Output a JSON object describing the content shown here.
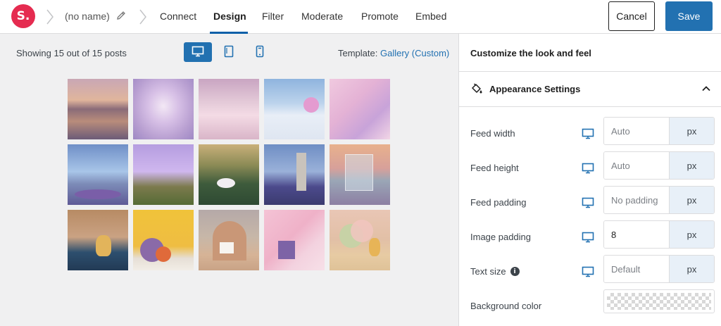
{
  "header": {
    "logo_text": "S.",
    "feed_name": "(no name)",
    "tabs": [
      {
        "label": "Connect",
        "active": false
      },
      {
        "label": "Design",
        "active": true
      },
      {
        "label": "Filter",
        "active": false
      },
      {
        "label": "Moderate",
        "active": false
      },
      {
        "label": "Promote",
        "active": false
      },
      {
        "label": "Embed",
        "active": false
      }
    ],
    "cancel_label": "Cancel",
    "save_label": "Save"
  },
  "preview": {
    "showing_text": "Showing 15 out of 15 posts",
    "devices": [
      {
        "name": "desktop",
        "active": true
      },
      {
        "name": "tablet",
        "active": false
      },
      {
        "name": "mobile",
        "active": false
      }
    ],
    "template_label": "Template:",
    "template_value": "Gallery (Custom)",
    "posts_count": 15
  },
  "sidebar": {
    "title": "Customize the look and feel",
    "section_title": "Appearance Settings",
    "section_expanded": true,
    "fields": [
      {
        "label": "Feed width",
        "value": "",
        "placeholder": "Auto",
        "unit": "px",
        "info": false
      },
      {
        "label": "Feed height",
        "value": "",
        "placeholder": "Auto",
        "unit": "px",
        "info": false
      },
      {
        "label": "Feed padding",
        "value": "",
        "placeholder": "No padding",
        "unit": "px",
        "info": false
      },
      {
        "label": "Image padding",
        "value": "8",
        "placeholder": "",
        "unit": "px",
        "info": false
      },
      {
        "label": "Text size",
        "value": "",
        "placeholder": "Default",
        "unit": "px",
        "info": true
      }
    ],
    "background_color_label": "Background color"
  },
  "colors": {
    "brand": "#e52b50",
    "accent": "#2271b1",
    "active_underline": "#0a5fa8"
  }
}
